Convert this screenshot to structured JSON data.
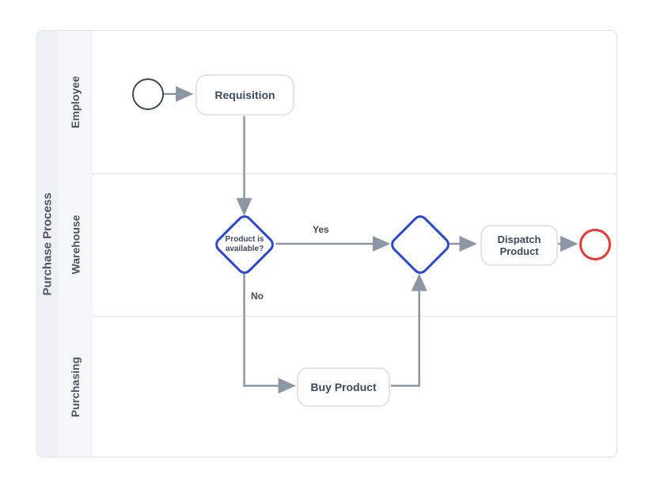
{
  "pool": {
    "title": "Purchase Process"
  },
  "lanes": {
    "lane1": "Employee",
    "lane2": "Warehouse",
    "lane3": "Purchasing"
  },
  "tasks": {
    "requisition": "Requisition",
    "dispatch": "Dispatch Product",
    "buy": "Buy Product"
  },
  "gateways": {
    "decision_label": "Product is available?",
    "yes": "Yes",
    "no": "No"
  }
}
